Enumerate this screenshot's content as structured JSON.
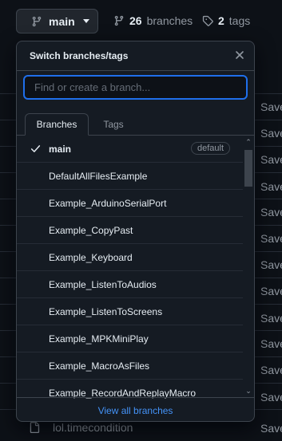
{
  "header": {
    "branch_button_label": "main",
    "branches_count": "26",
    "branches_label": "branches",
    "tags_count": "2",
    "tags_label": "tags"
  },
  "background": {
    "save_text": "Save",
    "file_name": "lol.timecondition"
  },
  "dropdown": {
    "title": "Switch branches/tags",
    "search_placeholder": "Find or create a branch...",
    "tabs": [
      "Branches",
      "Tags"
    ],
    "default_badge": "default",
    "branches": [
      "main",
      "DefaultAllFilesExample",
      "Example_ArduinoSerialPort",
      "Example_CopyPast",
      "Example_Keyboard",
      "Example_ListenToAudios",
      "Example_ListenToScreens",
      "Example_MPKMiniPlay",
      "Example_MacroAsFiles",
      "Example_RecordAndReplayMacro"
    ],
    "footer_link": "View all branches"
  },
  "colors": {
    "background": "#0d1117",
    "panel": "#151b23",
    "border": "#3d444d",
    "accent_blue": "#4493f8",
    "focus_blue": "#1f6feb"
  }
}
